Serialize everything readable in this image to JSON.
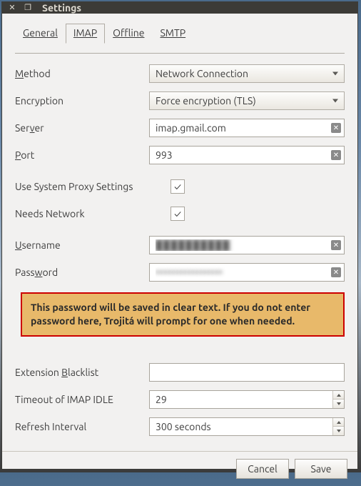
{
  "window": {
    "title": "Settings"
  },
  "tabs": {
    "general": "General",
    "imap": "IMAP",
    "offline": "Offline",
    "smtp": "SMTP"
  },
  "labels": {
    "method": "Method",
    "encryption": "Encryption",
    "server": "Server",
    "port": "Port",
    "proxy": "Use System Proxy Settings",
    "needs_network": "Needs Network",
    "username": "Username",
    "password": "Password",
    "blacklist": "Extension Blacklist",
    "idle": "Timeout of IMAP IDLE",
    "refresh": "Refresh Interval"
  },
  "values": {
    "method": "Network Connection",
    "encryption": "Force encryption (TLS)",
    "server": "imap.gmail.com",
    "port": "993",
    "proxy_checked": true,
    "needs_network_checked": true,
    "username": "██████████",
    "password": "•••••••••••••••••",
    "blacklist": "",
    "idle": "29",
    "refresh": "300 seconds"
  },
  "warning": "This password will be saved in clear text. If you do not enter password here, Trojitá will prompt for one when needed.",
  "buttons": {
    "cancel": "Cancel",
    "save": "Save"
  },
  "glyphs": {
    "close": "✕",
    "restore": "❐",
    "check": "✓",
    "clear": "✕"
  }
}
